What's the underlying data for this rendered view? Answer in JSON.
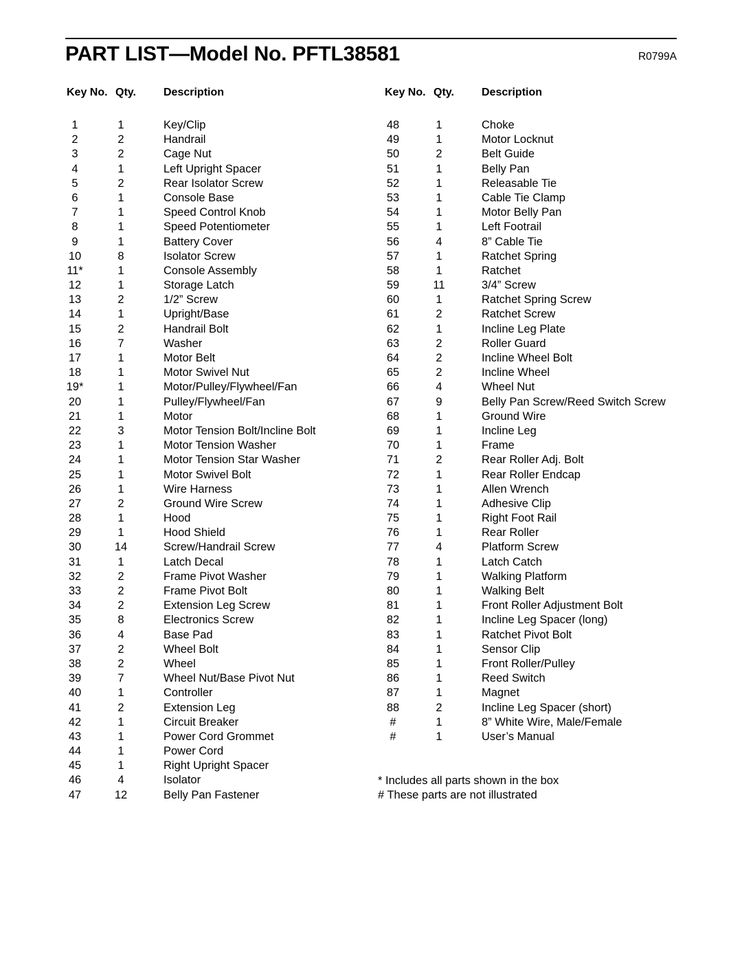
{
  "document": {
    "title": "PART LIST—Model No. PFTL38581",
    "revision": "R0799A"
  },
  "table": {
    "headers": {
      "key_no": "Key No.",
      "qty": "Qty.",
      "description": "Description"
    },
    "left_column": [
      {
        "key": "1",
        "qty": "1",
        "description": "Key/Clip"
      },
      {
        "key": "2",
        "qty": "2",
        "description": "Handrail"
      },
      {
        "key": "3",
        "qty": "2",
        "description": "Cage Nut"
      },
      {
        "key": "4",
        "qty": "1",
        "description": "Left Upright Spacer"
      },
      {
        "key": "5",
        "qty": "2",
        "description": "Rear Isolator Screw"
      },
      {
        "key": "6",
        "qty": "1",
        "description": "Console Base"
      },
      {
        "key": "7",
        "qty": "1",
        "description": "Speed Control Knob"
      },
      {
        "key": "8",
        "qty": "1",
        "description": "Speed Potentiometer"
      },
      {
        "key": "9",
        "qty": "1",
        "description": "Battery Cover"
      },
      {
        "key": "10",
        "qty": "8",
        "description": "Isolator Screw"
      },
      {
        "key": "11*",
        "qty": "1",
        "description": "Console Assembly"
      },
      {
        "key": "12",
        "qty": "1",
        "description": "Storage Latch"
      },
      {
        "key": "13",
        "qty": "2",
        "description": "1/2” Screw"
      },
      {
        "key": "14",
        "qty": "1",
        "description": "Upright/Base"
      },
      {
        "key": "15",
        "qty": "2",
        "description": "Handrail Bolt"
      },
      {
        "key": "16",
        "qty": "7",
        "description": "Washer"
      },
      {
        "key": "17",
        "qty": "1",
        "description": "Motor Belt"
      },
      {
        "key": "18",
        "qty": "1",
        "description": "Motor Swivel Nut"
      },
      {
        "key": "19*",
        "qty": "1",
        "description": "Motor/Pulley/Flywheel/Fan"
      },
      {
        "key": "20",
        "qty": "1",
        "description": "Pulley/Flywheel/Fan"
      },
      {
        "key": "21",
        "qty": "1",
        "description": "Motor"
      },
      {
        "key": "22",
        "qty": "3",
        "description": "Motor Tension Bolt/Incline Bolt"
      },
      {
        "key": "23",
        "qty": "1",
        "description": "Motor Tension Washer"
      },
      {
        "key": "24",
        "qty": "1",
        "description": "Motor Tension Star Washer"
      },
      {
        "key": "25",
        "qty": "1",
        "description": "Motor Swivel Bolt"
      },
      {
        "key": "26",
        "qty": "1",
        "description": "Wire Harness"
      },
      {
        "key": "27",
        "qty": "2",
        "description": "Ground Wire Screw"
      },
      {
        "key": "28",
        "qty": "1",
        "description": "Hood"
      },
      {
        "key": "29",
        "qty": "1",
        "description": "Hood Shield"
      },
      {
        "key": "30",
        "qty": "14",
        "description": "Screw/Handrail Screw"
      },
      {
        "key": "31",
        "qty": "1",
        "description": "Latch Decal"
      },
      {
        "key": "32",
        "qty": "2",
        "description": "Frame Pivot Washer"
      },
      {
        "key": "33",
        "qty": "2",
        "description": "Frame Pivot Bolt"
      },
      {
        "key": "34",
        "qty": "2",
        "description": "Extension Leg Screw"
      },
      {
        "key": "35",
        "qty": "8",
        "description": "Electronics Screw"
      },
      {
        "key": "36",
        "qty": "4",
        "description": "Base Pad"
      },
      {
        "key": "37",
        "qty": "2",
        "description": "Wheel Bolt"
      },
      {
        "key": "38",
        "qty": "2",
        "description": "Wheel"
      },
      {
        "key": "39",
        "qty": "7",
        "description": "Wheel Nut/Base Pivot Nut"
      },
      {
        "key": "40",
        "qty": "1",
        "description": "Controller"
      },
      {
        "key": "41",
        "qty": "2",
        "description": "Extension Leg"
      },
      {
        "key": "42",
        "qty": "1",
        "description": "Circuit Breaker"
      },
      {
        "key": "43",
        "qty": "1",
        "description": "Power Cord Grommet"
      },
      {
        "key": "44",
        "qty": "1",
        "description": "Power Cord"
      },
      {
        "key": "45",
        "qty": "1",
        "description": "Right Upright Spacer"
      },
      {
        "key": "46",
        "qty": "4",
        "description": "Isolator"
      },
      {
        "key": "47",
        "qty": "12",
        "description": "Belly Pan Fastener"
      }
    ],
    "right_column": [
      {
        "key": "48",
        "qty": "1",
        "description": "Choke"
      },
      {
        "key": "49",
        "qty": "1",
        "description": "Motor Locknut"
      },
      {
        "key": "50",
        "qty": "2",
        "description": "Belt Guide"
      },
      {
        "key": "51",
        "qty": "1",
        "description": "Belly Pan"
      },
      {
        "key": "52",
        "qty": "1",
        "description": "Releasable Tie"
      },
      {
        "key": "53",
        "qty": "1",
        "description": "Cable Tie Clamp"
      },
      {
        "key": "54",
        "qty": "1",
        "description": "Motor Belly Pan"
      },
      {
        "key": "55",
        "qty": "1",
        "description": "Left Footrail"
      },
      {
        "key": "56",
        "qty": "4",
        "description": "8” Cable Tie"
      },
      {
        "key": "57",
        "qty": "1",
        "description": "Ratchet Spring"
      },
      {
        "key": "58",
        "qty": "1",
        "description": "Ratchet"
      },
      {
        "key": "59",
        "qty": "11",
        "description": "3/4” Screw"
      },
      {
        "key": "60",
        "qty": "1",
        "description": "Ratchet Spring Screw"
      },
      {
        "key": "61",
        "qty": "2",
        "description": "Ratchet Screw"
      },
      {
        "key": "62",
        "qty": "1",
        "description": "Incline Leg Plate"
      },
      {
        "key": "63",
        "qty": "2",
        "description": "Roller Guard"
      },
      {
        "key": "64",
        "qty": "2",
        "description": "Incline Wheel Bolt"
      },
      {
        "key": "65",
        "qty": "2",
        "description": "Incline Wheel"
      },
      {
        "key": "66",
        "qty": "4",
        "description": "Wheel Nut"
      },
      {
        "key": "67",
        "qty": "9",
        "description": "Belly Pan Screw/Reed Switch Screw"
      },
      {
        "key": "68",
        "qty": "1",
        "description": "Ground Wire"
      },
      {
        "key": "69",
        "qty": "1",
        "description": "Incline Leg"
      },
      {
        "key": "70",
        "qty": "1",
        "description": "Frame"
      },
      {
        "key": "71",
        "qty": "2",
        "description": "Rear Roller Adj. Bolt"
      },
      {
        "key": "72",
        "qty": "1",
        "description": "Rear Roller Endcap"
      },
      {
        "key": "73",
        "qty": "1",
        "description": "Allen Wrench"
      },
      {
        "key": "74",
        "qty": "1",
        "description": "Adhesive Clip"
      },
      {
        "key": "75",
        "qty": "1",
        "description": "Right Foot Rail"
      },
      {
        "key": "76",
        "qty": "1",
        "description": "Rear Roller"
      },
      {
        "key": "77",
        "qty": "4",
        "description": "Platform Screw"
      },
      {
        "key": "78",
        "qty": "1",
        "description": "Latch Catch"
      },
      {
        "key": "79",
        "qty": "1",
        "description": "Walking Platform"
      },
      {
        "key": "80",
        "qty": "1",
        "description": "Walking Belt"
      },
      {
        "key": "81",
        "qty": "1",
        "description": "Front Roller Adjustment Bolt"
      },
      {
        "key": "82",
        "qty": "1",
        "description": "Incline Leg Spacer (long)"
      },
      {
        "key": "83",
        "qty": "1",
        "description": "Ratchet Pivot Bolt"
      },
      {
        "key": "84",
        "qty": "1",
        "description": "Sensor Clip"
      },
      {
        "key": "85",
        "qty": "1",
        "description": "Front Roller/Pulley"
      },
      {
        "key": "86",
        "qty": "1",
        "description": "Reed Switch"
      },
      {
        "key": "87",
        "qty": "1",
        "description": "Magnet"
      },
      {
        "key": "88",
        "qty": "2",
        "description": "Incline Leg Spacer (short)"
      },
      {
        "key": "#",
        "qty": "1",
        "description": "8” White Wire, Male/Female"
      },
      {
        "key": "#",
        "qty": "1",
        "description": "User’s Manual"
      }
    ]
  },
  "footnotes": [
    "* Includes all parts shown in the box",
    "# These parts are not illustrated"
  ]
}
